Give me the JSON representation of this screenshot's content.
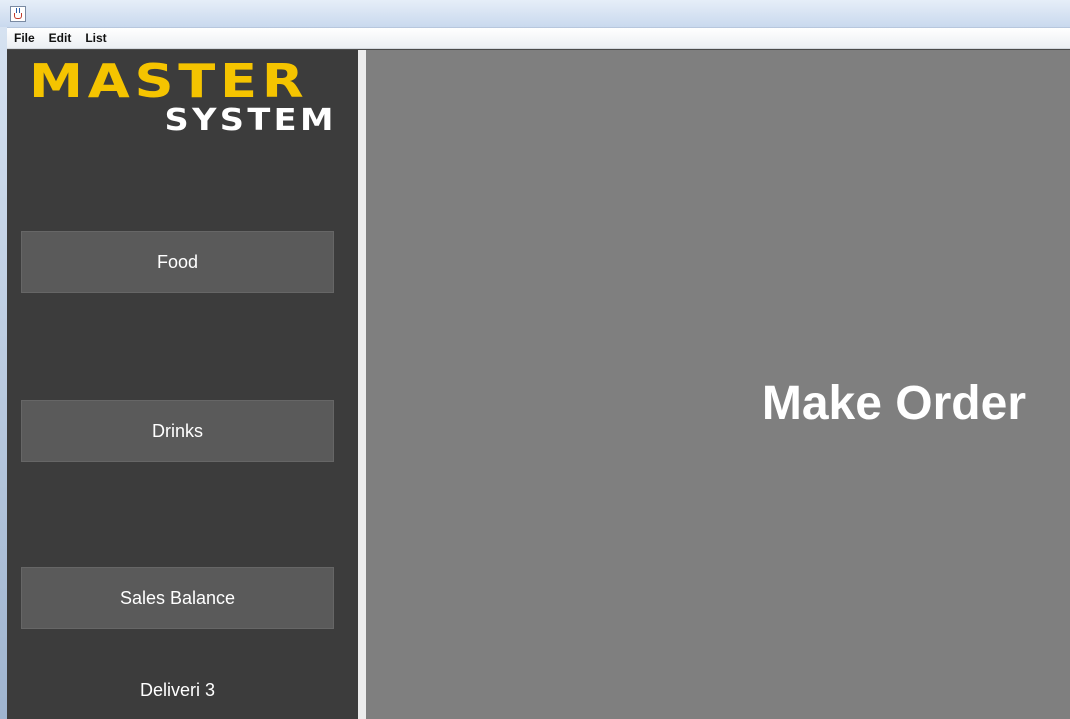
{
  "menubar": {
    "items": [
      {
        "label": "File"
      },
      {
        "label": "Edit"
      },
      {
        "label": "List"
      }
    ]
  },
  "logo": {
    "line1": "MASTER",
    "line2": "SYSTEM"
  },
  "sidebar": {
    "buttons": [
      {
        "label": "Food"
      },
      {
        "label": "Drinks"
      },
      {
        "label": "Sales Balance"
      }
    ],
    "footer_label": "Deliveri 3"
  },
  "main": {
    "heading": "Make Order"
  },
  "colors": {
    "sidebar_bg": "#3c3c3c",
    "main_bg": "#7f7f7f",
    "button_bg": "#5a5a5a",
    "logo_accent": "#f5c400",
    "text": "#ffffff"
  },
  "icons": {
    "app_icon": "java-cup-icon"
  }
}
